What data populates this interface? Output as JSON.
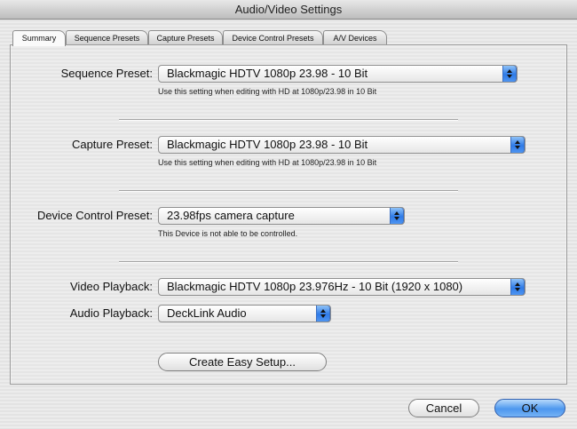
{
  "window": {
    "title": "Audio/Video Settings"
  },
  "tabs": [
    {
      "label": "Summary",
      "selected": true
    },
    {
      "label": "Sequence Presets",
      "selected": false
    },
    {
      "label": "Capture Presets",
      "selected": false
    },
    {
      "label": "Device Control Presets",
      "selected": false
    },
    {
      "label": "A/V Devices",
      "selected": false
    }
  ],
  "summary": {
    "sequence_preset": {
      "label": "Sequence Preset:",
      "value": "Blackmagic HDTV 1080p 23.98 - 10 Bit",
      "note": "Use this setting when editing with HD at 1080p/23.98 in 10 Bit"
    },
    "capture_preset": {
      "label": "Capture Preset:",
      "value": "Blackmagic HDTV 1080p 23.98 - 10 Bit",
      "note": "Use this setting when editing with HD at 1080p/23.98 in 10 Bit"
    },
    "device_control_preset": {
      "label": "Device Control Preset:",
      "value": "23.98fps camera capture",
      "note": "This Device is not able to be controlled."
    },
    "video_playback": {
      "label": "Video Playback:",
      "value": "Blackmagic HDTV 1080p 23.976Hz - 10 Bit (1920 x 1080)"
    },
    "audio_playback": {
      "label": "Audio Playback:",
      "value": "DeckLink Audio"
    },
    "create_easy_setup_label": "Create Easy Setup..."
  },
  "footer": {
    "cancel_label": "Cancel",
    "ok_label": "OK"
  },
  "colors": {
    "accent": "#2f7be8",
    "default_button": "#4d97ee"
  }
}
